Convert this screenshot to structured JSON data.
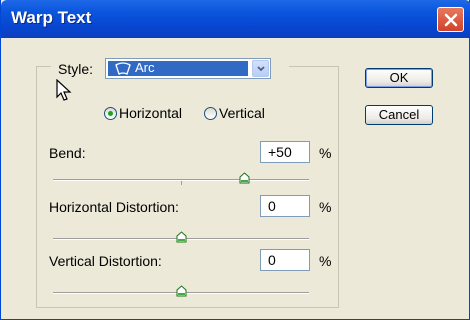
{
  "window": {
    "title": "Warp Text"
  },
  "style": {
    "label": "Style:",
    "selected": "Arc"
  },
  "orientation": {
    "horizontal_label": "Horizontal",
    "vertical_label": "Vertical",
    "selected": "Horizontal"
  },
  "bend": {
    "label": "Bend:",
    "value": "+50",
    "unit": "%",
    "slider_value": 50
  },
  "horizontal_distortion": {
    "label": "Horizontal Distortion:",
    "value": "0",
    "unit": "%",
    "slider_value": 0
  },
  "vertical_distortion": {
    "label": "Vertical Distortion:",
    "value": "0",
    "unit": "%",
    "slider_value": 0
  },
  "buttons": {
    "ok": "OK",
    "cancel": "Cancel"
  },
  "colors": {
    "title_bar": "#0a56dc",
    "dialog_bg": "#ece9d8",
    "selection": "#316ac5",
    "close": "#d0422a"
  }
}
